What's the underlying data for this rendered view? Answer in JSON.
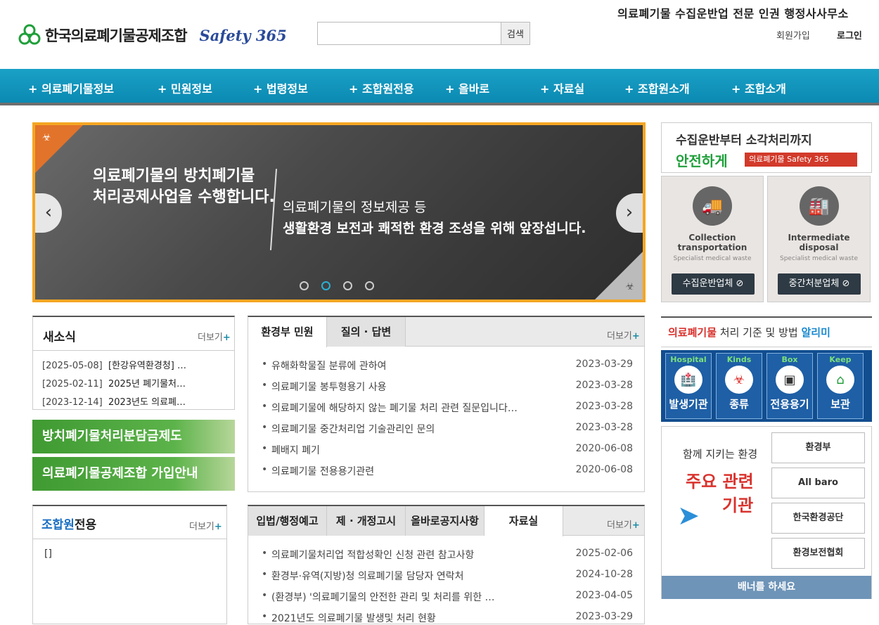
{
  "header": {
    "top_title": "의료폐기물 수집운반업 전문 인권 행정사사무소",
    "logo_text": "한국의료폐기물공제조합",
    "logo_tagline": "Safety 365",
    "search_placeholder": "",
    "search_button": "검색",
    "join": "회원가입",
    "login": "로그인"
  },
  "nav": {
    "items": [
      "+ 의료폐기물정보",
      "+ 민원정보",
      "+ 법령정보",
      "+ 조합원전용",
      "+ 올바로",
      "+ 자료실",
      "+ 조합원소개",
      "+ 조합소개"
    ]
  },
  "slider": {
    "line1_a": "의료폐기물의 방치폐기물",
    "line1_b": "처리공제사업을 수행합니다.",
    "line2_a": "의료폐기물의 정보제공 등",
    "line2_b": "생활환경 보전과 쾌적한 환경 조성을 위해 앞장섭니다.",
    "prev": "‹",
    "next": "›",
    "active_dot": 2
  },
  "promo": {
    "t1": "수집운반부터 소각처리까지",
    "t2": "안전하게",
    "badge": "의료폐기물 Safety 365"
  },
  "services": [
    {
      "en": "Collection transportation",
      "sub": "Specialist medical waste",
      "button": "수집운반업체 ⊘"
    },
    {
      "en": "Intermediate disposal",
      "sub": "Specialist medical waste",
      "button": "중간처분업체 ⊘"
    }
  ],
  "news": {
    "title": "새소식",
    "more": "더보기",
    "rows": [
      {
        "date": "[2025-05-08]",
        "text": "[한강유역환경청] …"
      },
      {
        "date": "[2025-02-11]",
        "text": "2025년 폐기물처…"
      },
      {
        "date": "[2023-12-14]",
        "text": "2023년도 의료폐…"
      }
    ]
  },
  "banners": {
    "b1": "방치폐기물처리분담금제도",
    "b2": "의료폐기물공제조합 가입안내"
  },
  "members": {
    "title_a": "조합원",
    "title_b": "전용",
    "more": "더보기",
    "placeholder": "[]"
  },
  "board1": {
    "tabs": [
      "환경부 민원",
      "질의 · 답변"
    ],
    "more": "더보기",
    "rows": [
      {
        "text": "유해화학물질 분류에 관하여",
        "date": "2023-03-29"
      },
      {
        "text": "의료폐기물 봉투형용기 사용",
        "date": "2023-03-28"
      },
      {
        "text": "의료폐기물에 해당하지 않는 폐기물 처리 관련 질문입니다…",
        "date": "2023-03-28"
      },
      {
        "text": "의료폐기물 중간처리업 기술관리인 문의",
        "date": "2023-03-28"
      },
      {
        "text": "폐배지 폐기",
        "date": "2020-06-08"
      },
      {
        "text": "의료폐기물 전용용기관련",
        "date": "2020-06-08"
      }
    ]
  },
  "board2": {
    "tabs": [
      "입법/행정예고",
      "제 · 개정고시",
      "올바로공지사항",
      "자료실"
    ],
    "more": "더보기",
    "rows": [
      {
        "text": "의료폐기물처리업 적합성확인 신청 관련 참고사항",
        "date": "2025-02-06"
      },
      {
        "text": "환경부·유역(지방)청 의료폐기물 담당자 연락처",
        "date": "2024-10-28"
      },
      {
        "text": "(환경부) '의료폐기물의 안전한 관리 및 처리를 위한 …",
        "date": "2023-04-05"
      },
      {
        "text": "2021년도 의료폐기물 발생및 처리 현황",
        "date": "2023-03-29"
      }
    ]
  },
  "info": {
    "title_a": "의료폐기물",
    "title_b": " 처리 기준 및 방법 ",
    "title_c": "알리미",
    "cells": [
      {
        "en": "Hospital",
        "ko": "발생기관"
      },
      {
        "en": "Kinds",
        "ko": "종류"
      },
      {
        "en": "Box",
        "ko": "전용용기"
      },
      {
        "en": "Keep",
        "ko": "보관"
      }
    ]
  },
  "agencies": {
    "l1": "함께 지키는 환경",
    "l2": "주요 관련",
    "l3": "기관",
    "items": [
      "환경부",
      "All baro",
      "한국환경공단",
      "환경보전협회"
    ],
    "footer": "배너를 하세요"
  },
  "colors": {
    "nav": "#1aa0c6",
    "slider_border": "#f5a623",
    "green": "#1f9f3a",
    "red": "#d9322d"
  }
}
